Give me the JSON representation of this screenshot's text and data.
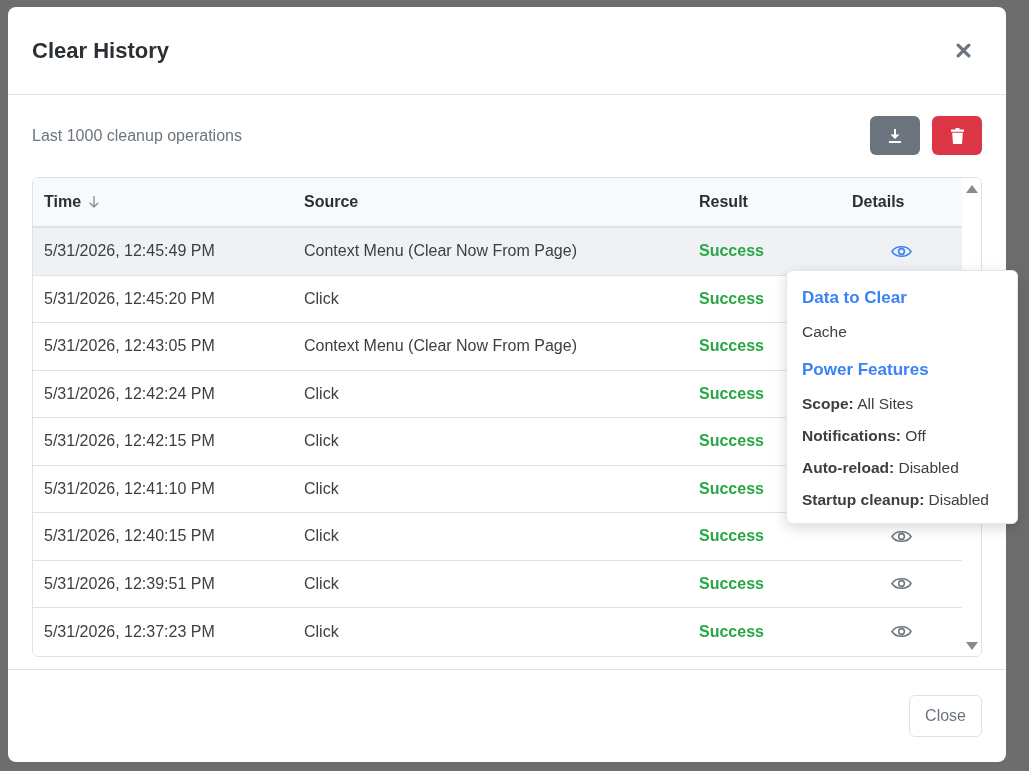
{
  "dialog": {
    "title": "Clear History",
    "caption": "Last 1000 cleanup operations",
    "actions": [
      {
        "kind": "download"
      },
      {
        "kind": "delete"
      }
    ]
  },
  "table": {
    "columns": [
      {
        "label": "Time",
        "sorted": true
      },
      {
        "label": "Source",
        "sorted": false
      },
      {
        "label": "Result",
        "sorted": false
      },
      {
        "label": "Details",
        "sorted": false
      }
    ],
    "rows": [
      {
        "time": "5/31/2026, 12:45:49 PM",
        "source": "Context Menu (Clear Now From Page)",
        "result": "Success",
        "hovered": true
      },
      {
        "time": "5/31/2026, 12:45:20 PM",
        "source": "Click",
        "result": "Success",
        "hovered": false
      },
      {
        "time": "5/31/2026, 12:43:05 PM",
        "source": "Context Menu (Clear Now From Page)",
        "result": "Success",
        "hovered": false
      },
      {
        "time": "5/31/2026, 12:42:24 PM",
        "source": "Click",
        "result": "Success",
        "hovered": false
      },
      {
        "time": "5/31/2026, 12:42:15 PM",
        "source": "Click",
        "result": "Success",
        "hovered": false
      },
      {
        "time": "5/31/2026, 12:41:10 PM",
        "source": "Click",
        "result": "Success",
        "hovered": false
      },
      {
        "time": "5/31/2026, 12:40:15 PM",
        "source": "Click",
        "result": "Success",
        "hovered": false
      },
      {
        "time": "5/31/2026, 12:39:51 PM",
        "source": "Click",
        "result": "Success",
        "hovered": false
      },
      {
        "time": "5/31/2026, 12:37:23 PM",
        "source": "Click",
        "result": "Success",
        "hovered": false
      }
    ]
  },
  "details_popover": {
    "sections": [
      {
        "heading": "Data to Clear",
        "lines": [
          "Cache"
        ]
      },
      {
        "heading": "Power Features",
        "lines": [
          "**Scope:** All Sites",
          "**Notifications:** Off",
          "**Auto-reload:** Disabled",
          "**Startup cleanup:** Disabled"
        ]
      }
    ]
  },
  "footer": {
    "close_label": "Close"
  }
}
